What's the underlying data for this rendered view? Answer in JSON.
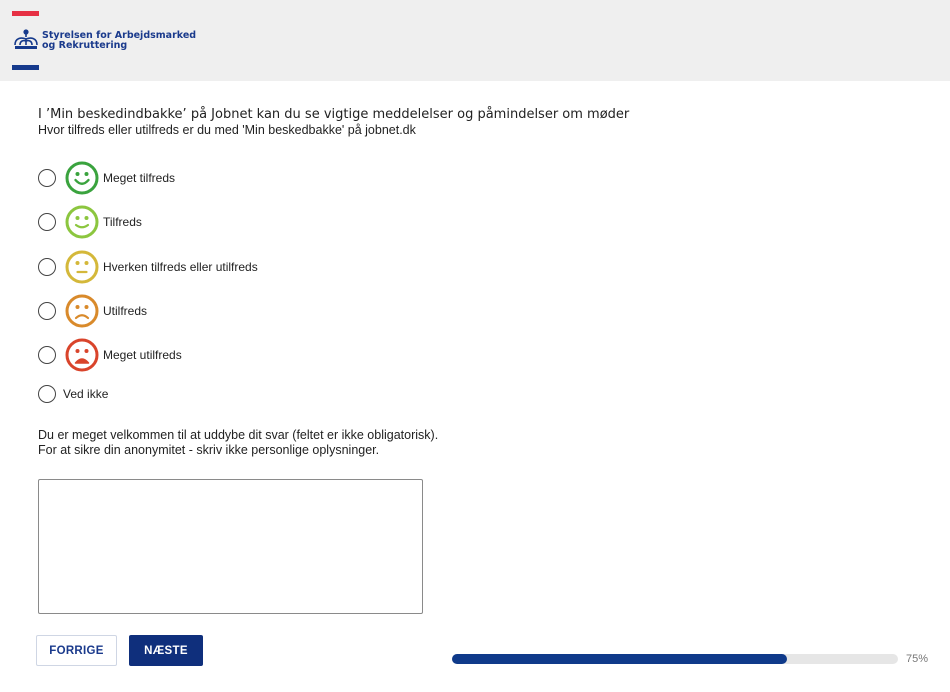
{
  "header": {
    "logo_line1": "Styrelsen for Arbejdsmarked",
    "logo_line2": "og Rekruttering",
    "colors": {
      "red": "#e63044",
      "blue": "#163a8c"
    }
  },
  "question": {
    "line1": "I ’Min beskedindbakke’ på Jobnet kan du se vigtige meddelelser og påmindelser om møder",
    "line2": "Hvor tilfreds eller utilfreds er du med 'Min beskedbakke' på jobnet.dk"
  },
  "options": [
    {
      "label": "Meget tilfreds",
      "icon": "very-happy-smiley-icon",
      "color": "#3aa33e"
    },
    {
      "label": "Tilfreds",
      "icon": "happy-smiley-icon",
      "color": "#8cc63f"
    },
    {
      "label": "Hverken tilfreds eller utilfreds",
      "icon": "neutral-smiley-icon",
      "color": "#d4b83a"
    },
    {
      "label": "Utilfreds",
      "icon": "sad-smiley-icon",
      "color": "#d98a2b"
    },
    {
      "label": "Meget utilfreds",
      "icon": "very-sad-smiley-icon",
      "color": "#d9442b"
    },
    {
      "label": "Ved ikke"
    }
  ],
  "comment": {
    "line1": "Du er meget velkommen til at uddybe dit svar (feltet er ikke obligatorisk).",
    "line2": "For at sikre din anonymitet - skriv ikke personlige oplysninger.",
    "value": ""
  },
  "buttons": {
    "prev": "FORRIGE",
    "next": "NÆSTE"
  },
  "progress": {
    "percent": 75,
    "label": "75%"
  }
}
